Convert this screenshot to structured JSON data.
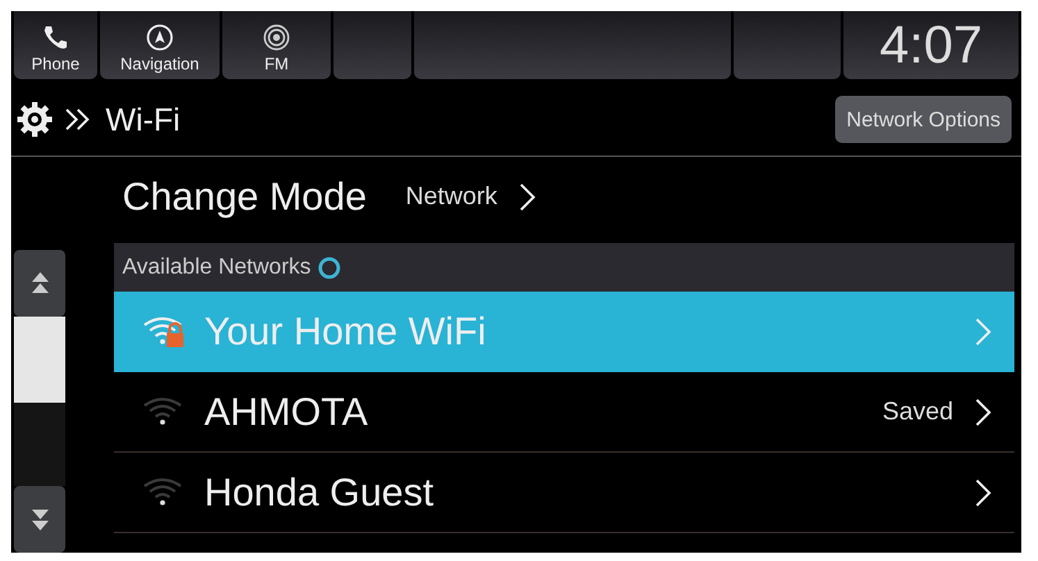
{
  "top_bar": {
    "tabs": [
      {
        "label": "Phone"
      },
      {
        "label": "Navigation"
      },
      {
        "label": "FM"
      }
    ],
    "clock": "4:07"
  },
  "header": {
    "breadcrumb": "Wi-Fi",
    "button": "Network Options"
  },
  "change_mode": {
    "label": "Change Mode",
    "value": "Network"
  },
  "networks_header": {
    "label": "Available Networks",
    "searching": true
  },
  "networks": [
    {
      "name": "Your Home WiFi",
      "secured": true,
      "selected": true
    },
    {
      "name": "AHMOTA",
      "secured": false,
      "selected": false,
      "status": "Saved"
    },
    {
      "name": "Honda Guest",
      "secured": false,
      "selected": false
    }
  ]
}
